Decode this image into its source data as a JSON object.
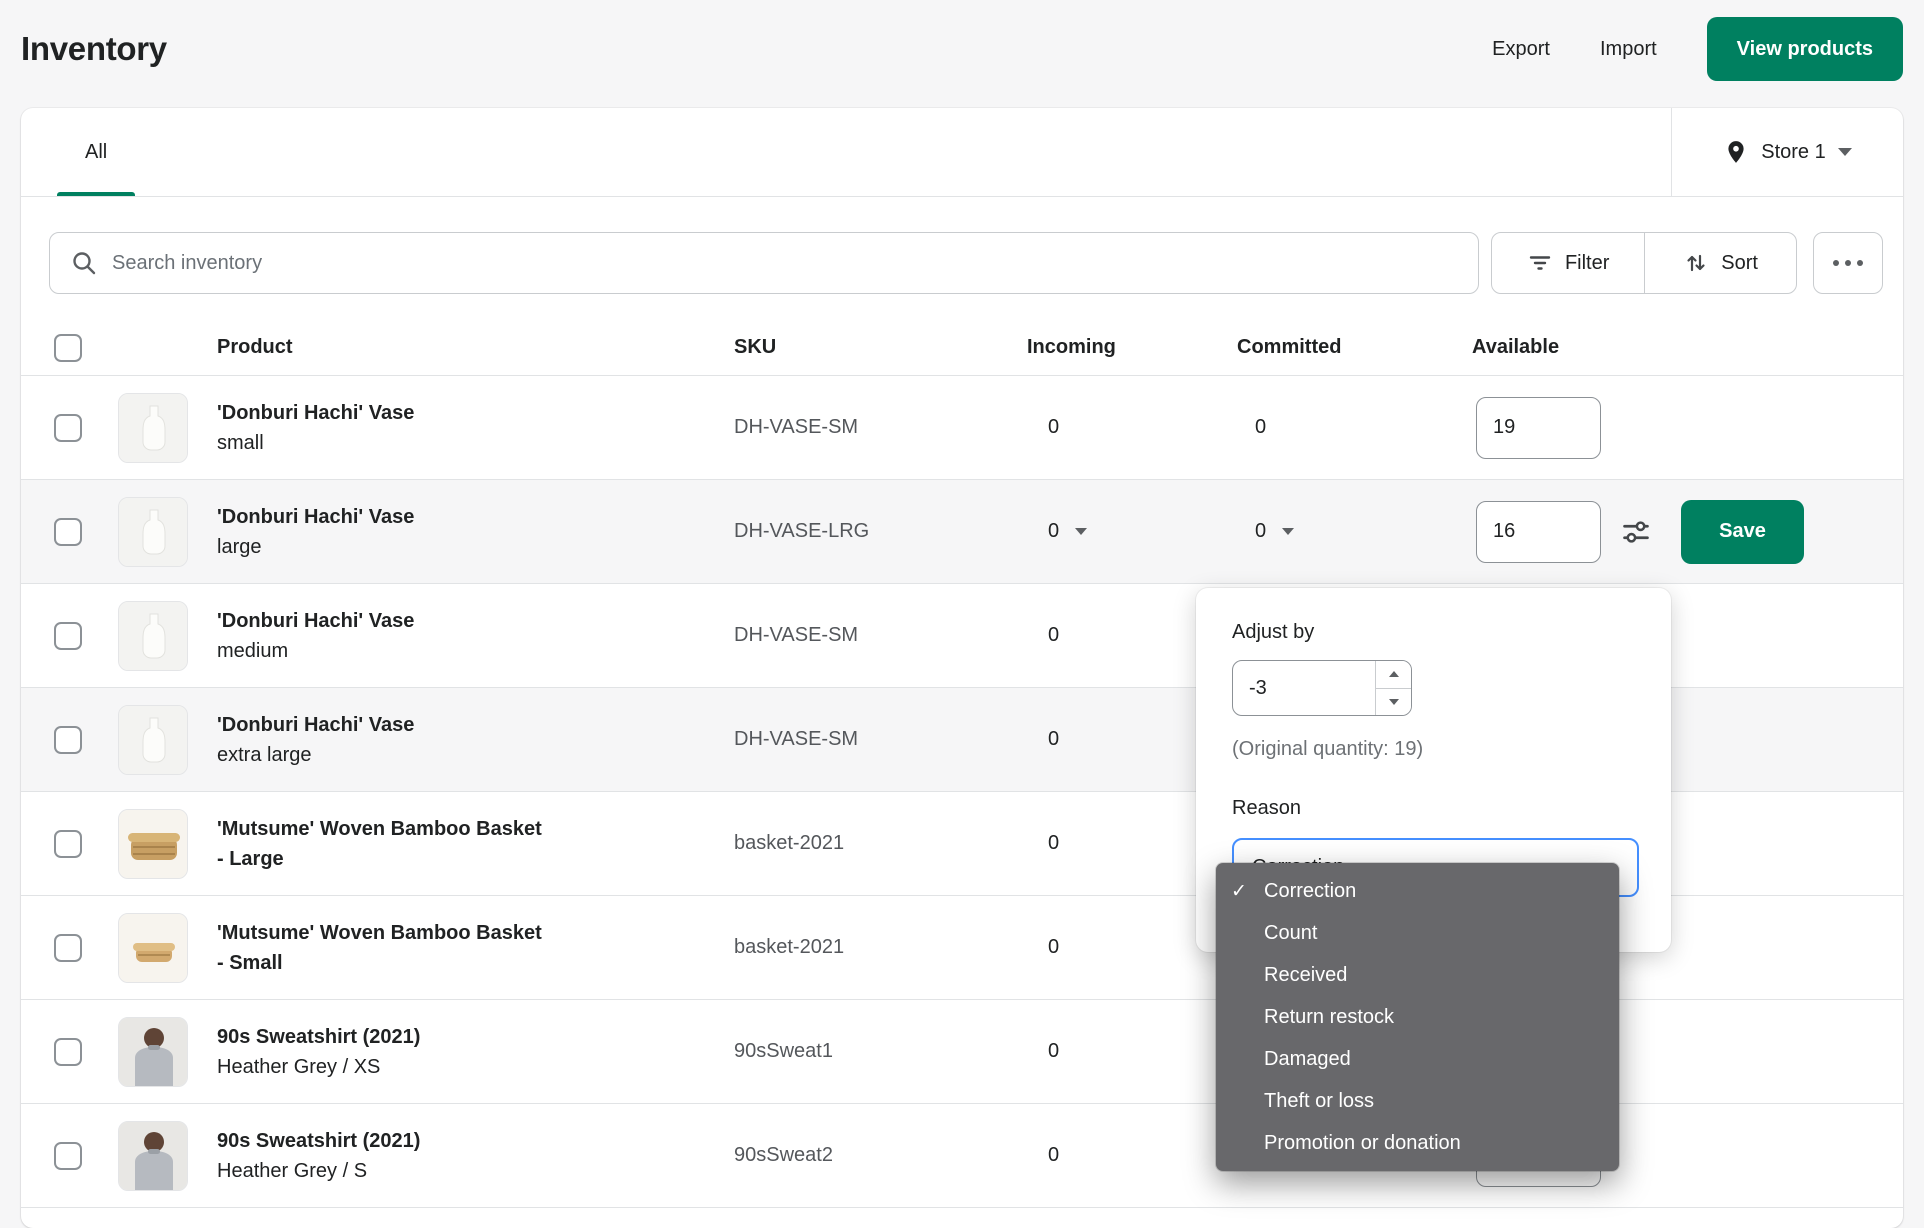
{
  "header": {
    "title": "Inventory",
    "export_label": "Export",
    "import_label": "Import",
    "view_products_label": "View products"
  },
  "tabs": {
    "all": "All"
  },
  "location": {
    "name": "Store 1"
  },
  "toolbar": {
    "search_placeholder": "Search inventory",
    "filter_label": "Filter",
    "sort_label": "Sort"
  },
  "table": {
    "product_header": "Product",
    "sku_header": "SKU",
    "incoming_header": "Incoming",
    "committed_header": "Committed",
    "available_header": "Available"
  },
  "rows": [
    {
      "name": "'Donburi Hachi' Vase",
      "variant": "small",
      "sku": "DH-VASE-SM",
      "incoming": "0",
      "committed": "0",
      "available": "19",
      "thumbnail": "vase"
    },
    {
      "name": "'Donburi Hachi' Vase",
      "variant": "large",
      "sku": "DH-VASE-LRG",
      "incoming": "0",
      "committed": "0",
      "available": "16",
      "thumbnail": "vase",
      "save_label": "Save"
    },
    {
      "name": "'Donburi Hachi' Vase",
      "variant": "medium",
      "sku": "DH-VASE-SM",
      "incoming": "0",
      "thumbnail": "vase"
    },
    {
      "name": "'Donburi Hachi' Vase",
      "variant": "extra large",
      "sku": "DH-VASE-SM",
      "incoming": "0",
      "thumbnail": "vase"
    },
    {
      "name": "'Mutsume' Woven Bamboo Basket - Large",
      "variant": "",
      "sku": "basket-2021",
      "incoming": "0",
      "thumbnail": "basket-large"
    },
    {
      "name": "'Mutsume' Woven Bamboo Basket - Small",
      "variant": "",
      "sku": "basket-2021",
      "incoming": "0",
      "thumbnail": "basket-small"
    },
    {
      "name": "90s Sweatshirt (2021)",
      "variant": "Heather Grey / XS",
      "sku": "90sSweat1",
      "incoming": "0",
      "thumbnail": "sweatshirt-model"
    },
    {
      "name": "90s Sweatshirt (2021)",
      "variant": "Heather Grey / S",
      "sku": "90sSweat2",
      "incoming": "0",
      "thumbnail": "sweatshirt-model"
    }
  ],
  "popover": {
    "adjust_by_label": "Adjust by",
    "adjust_value": "-3",
    "original_quantity_note": "(Original quantity: 19)",
    "reason_label": "Reason",
    "selected_reason": "Correction",
    "options": [
      "Correction",
      "Count",
      "Received",
      "Return restock",
      "Damaged",
      "Theft or loss",
      "Promotion or donation"
    ],
    "checked_option": "Correction"
  },
  "icons": {
    "check": "✓"
  },
  "colors": {
    "accent_green": "#008060",
    "focus_blue": "#458fff",
    "menu_grey": "#68686b",
    "page_bg": "#f6f6f7"
  }
}
